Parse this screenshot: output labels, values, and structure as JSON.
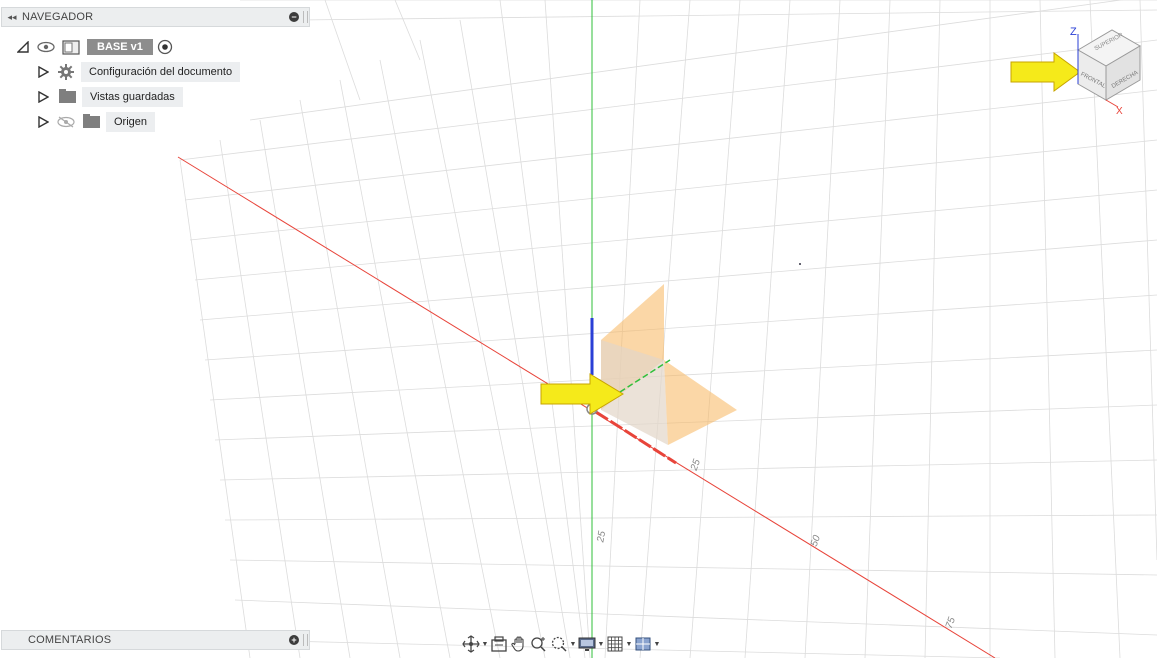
{
  "navigator": {
    "title": "NAVEGADOR",
    "collapse_glyph": "◂◂",
    "root": {
      "label": "BASE v1"
    },
    "items": [
      {
        "label": "Configuración del documento",
        "icon": "gear-icon"
      },
      {
        "label": "Vistas guardadas",
        "icon": "folder-icon"
      },
      {
        "label": "Origen",
        "icon": "folder-icon",
        "hidden_eye": true
      }
    ]
  },
  "comments": {
    "title": "COMENTARIOS"
  },
  "viewcube": {
    "faces": {
      "top": "SUPERIOR",
      "front": "FRONTAL",
      "right": "DERECHA"
    },
    "axis_z": "Z",
    "axis_x": "X"
  },
  "grid_labels": {
    "x_25": "25",
    "x_50": "50",
    "x_75": "75",
    "z_25": "25"
  },
  "colors": {
    "x_axis": "#e8443a",
    "y_axis": "#2fbf3a",
    "z_axis": "#2a3fd6",
    "plane": "#f7b65e",
    "arrow": "#f5ea1a",
    "grid": "#d9d9d9"
  }
}
